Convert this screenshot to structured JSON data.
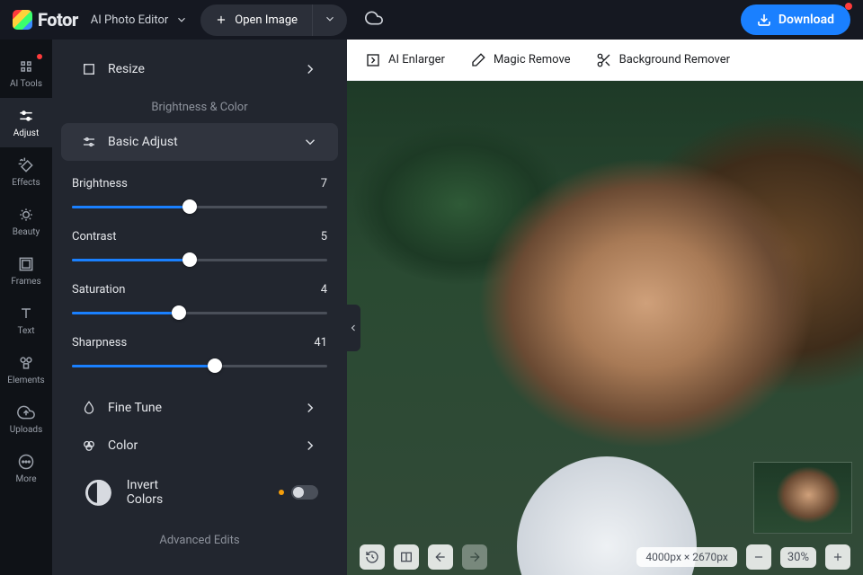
{
  "header": {
    "brand": "Fotor",
    "mode": "AI Photo Editor",
    "open_image": "Open Image",
    "download": "Download"
  },
  "nav": {
    "ai_tools": "AI Tools",
    "adjust": "Adjust",
    "effects": "Effects",
    "beauty": "Beauty",
    "frames": "Frames",
    "text": "Text",
    "elements": "Elements",
    "uploads": "Uploads",
    "more": "More"
  },
  "panel": {
    "resize": "Resize",
    "section1": "Brightness & Color",
    "basic_adjust": "Basic Adjust",
    "sliders": {
      "brightness": {
        "label": "Brightness",
        "value": 7,
        "pct": 46
      },
      "contrast": {
        "label": "Contrast",
        "value": 5,
        "pct": 46
      },
      "saturation": {
        "label": "Saturation",
        "value": 4,
        "pct": 42
      },
      "sharpness": {
        "label": "Sharpness",
        "value": 41,
        "pct": 56
      }
    },
    "fine_tune": "Fine Tune",
    "color": "Color",
    "invert": "Invert Colors",
    "section2": "Advanced Edits"
  },
  "tools": {
    "enlarger": "AI Enlarger",
    "magic_remove": "Magic Remove",
    "bg_remove": "Background Remover"
  },
  "footer": {
    "dimensions": "4000px × 2670px",
    "zoom": "30%"
  }
}
